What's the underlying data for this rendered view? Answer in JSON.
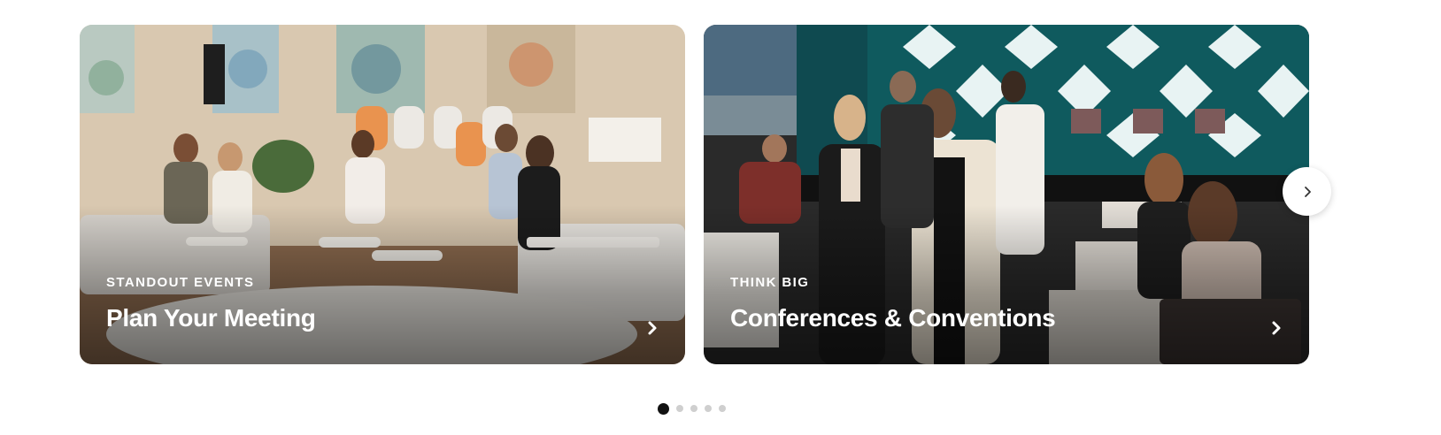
{
  "carousel": {
    "cards": [
      {
        "eyebrow": "STANDOUT EVENTS",
        "title": "Plan Your Meeting",
        "image": "lounge-meeting-photo",
        "arrow_icon": "chevron-right-icon"
      },
      {
        "eyebrow": "THINK BIG",
        "title": "Conferences & Conventions",
        "image": "conference-hall-photo",
        "arrow_icon": "chevron-right-icon"
      }
    ],
    "next_button": {
      "icon": "chevron-right-icon"
    },
    "pagination": {
      "total": 5,
      "active": 1
    }
  },
  "colors": {
    "text_on_image": "#ffffff",
    "active_dot": "#111111",
    "inactive_dot": "#cfcfcf"
  }
}
